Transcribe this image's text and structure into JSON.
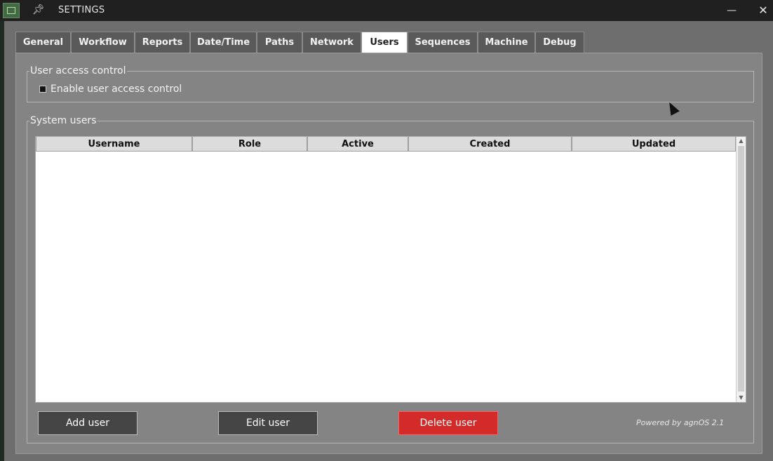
{
  "window": {
    "title": "SETTINGS",
    "minimize_glyph": "—",
    "close_glyph": "✕"
  },
  "tabs": [
    {
      "label": "General"
    },
    {
      "label": "Workflow"
    },
    {
      "label": "Reports"
    },
    {
      "label": "Date/Time"
    },
    {
      "label": "Paths"
    },
    {
      "label": "Network"
    },
    {
      "label": "Users",
      "active": true
    },
    {
      "label": "Sequences"
    },
    {
      "label": "Machine"
    },
    {
      "label": "Debug"
    }
  ],
  "access_control": {
    "group_title": "User access control",
    "checkbox_label": "Enable user access control",
    "checked": true
  },
  "system_users": {
    "group_title": "System users",
    "columns": [
      "Username",
      "Role",
      "Active",
      "Created",
      "Updated"
    ],
    "rows": []
  },
  "buttons": {
    "add": "Add user",
    "edit": "Edit user",
    "delete": "Delete user"
  },
  "footer": {
    "powered_by": "Powered by agnOS 2.1"
  },
  "icons": {
    "pin": "pin-icon",
    "minimize": "minimize-icon",
    "close": "close-icon",
    "app": "app-icon"
  },
  "colors": {
    "delete_button": "#d42a2a",
    "active_tab": "#ffffff",
    "panel": "#848484"
  }
}
